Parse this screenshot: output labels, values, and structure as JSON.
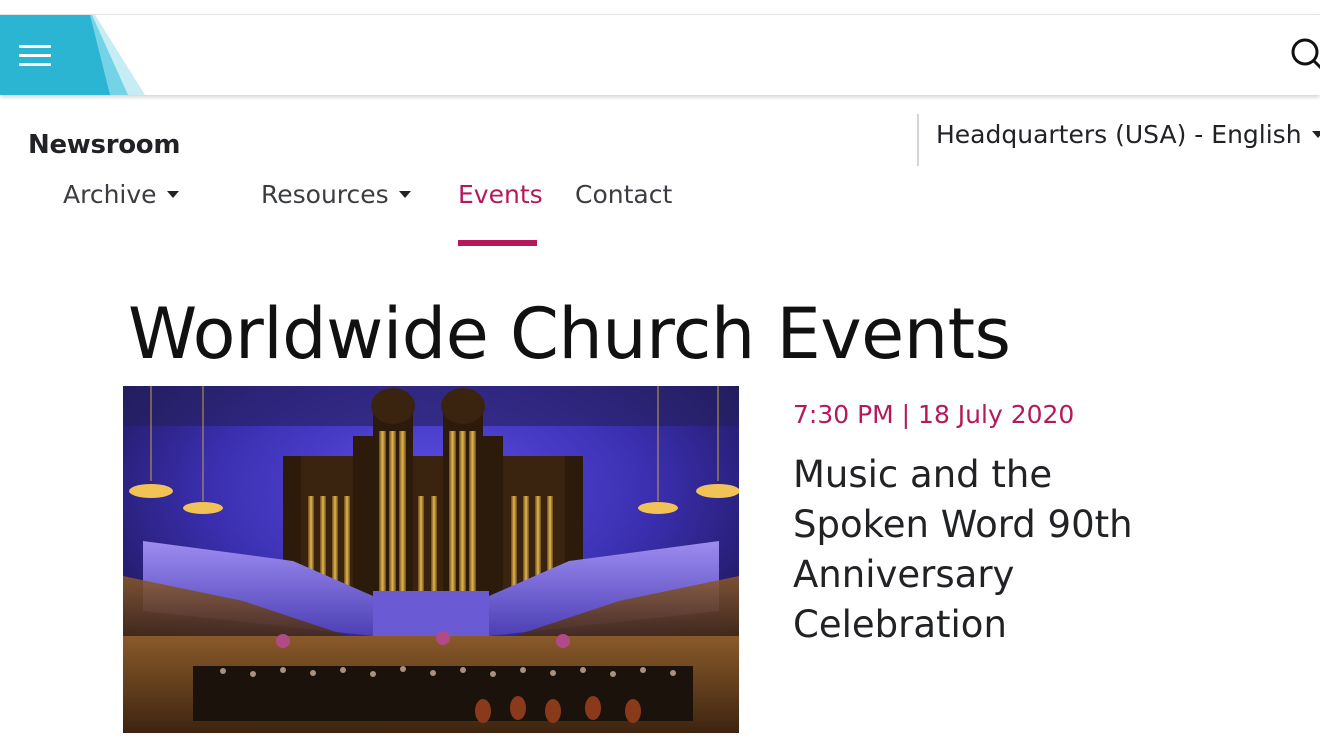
{
  "header": {
    "menu_icon": "hamburger-icon",
    "search_icon": "search-icon",
    "accent_color": "#2bb5d2"
  },
  "site": {
    "section_title": "Newsroom"
  },
  "nav": {
    "items": [
      {
        "label": "Archive",
        "has_dropdown": true
      },
      {
        "label": "Resources",
        "has_dropdown": true
      },
      {
        "label": "Events",
        "active": true
      },
      {
        "label": "Contact"
      }
    ],
    "active_color": "#b5195c"
  },
  "region_selector": {
    "label": "Headquarters (USA) - English",
    "icon": "caret-down-icon"
  },
  "main": {
    "title": "Worldwide Church Events",
    "featured_event": {
      "datetime": "7:30 PM | 18 July 2020",
      "title": "Music and the Spoken Word 90th Anniversary Celebration"
    }
  }
}
